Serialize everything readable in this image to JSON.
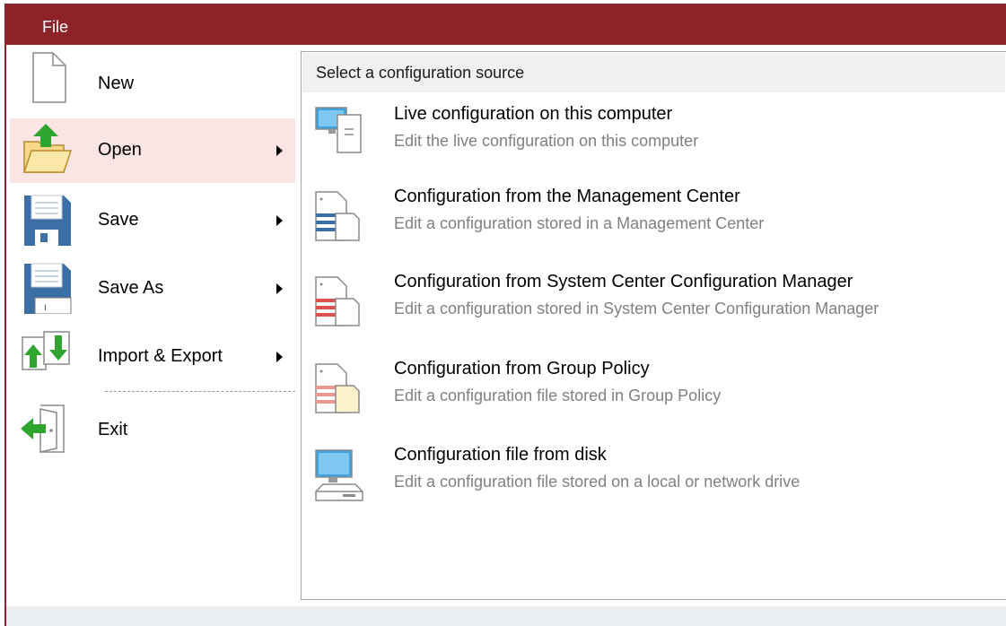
{
  "titlebar": {
    "file_tab": "File"
  },
  "menu": {
    "new": "New",
    "open": "Open",
    "save": "Save",
    "save_as": "Save As",
    "import_export": "Import & Export",
    "exit": "Exit"
  },
  "panel": {
    "header": "Select a configuration source",
    "sources": [
      {
        "title": "Live configuration on this computer",
        "desc": "Edit the live configuration on this computer",
        "icon": "computer-icon"
      },
      {
        "title": "Configuration from the Management Center",
        "desc": "Edit a configuration stored in a Management Center",
        "icon": "management-center-icon"
      },
      {
        "title": "Configuration from System Center Configuration Manager",
        "desc": "Edit a configuration stored in System Center Configuration Manager",
        "icon": "sccm-icon"
      },
      {
        "title": "Configuration from Group Policy",
        "desc": "Edit a configuration file stored in Group Policy",
        "icon": "group-policy-icon"
      },
      {
        "title": "Configuration file from disk",
        "desc": "Edit a configuration file stored on a local or network drive",
        "icon": "disk-icon"
      }
    ]
  },
  "colors": {
    "titlebar": "#8d2229",
    "active_item": "#fbe4e4",
    "desc_text": "#808080"
  }
}
